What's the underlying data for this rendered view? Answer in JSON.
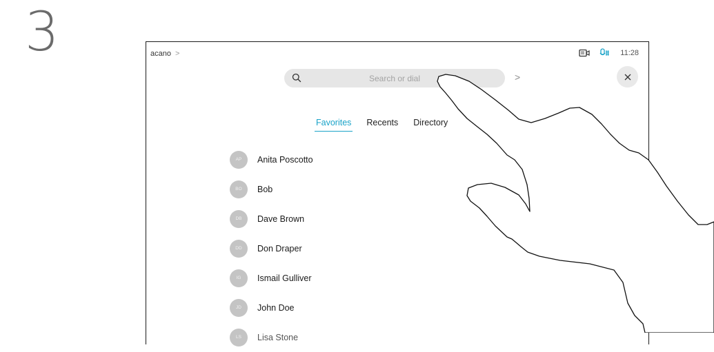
{
  "step": {
    "number": "3"
  },
  "header": {
    "breadcrumb": "acano",
    "time": "11:28",
    "icons": [
      "camera-icon",
      "microphone-icon"
    ]
  },
  "search": {
    "placeholder": "Search or dial",
    "value": ""
  },
  "tabs": [
    {
      "label": "Favorites",
      "active": true
    },
    {
      "label": "Recents",
      "active": false
    },
    {
      "label": "Directory",
      "active": false
    }
  ],
  "contacts": [
    {
      "initials": "AP",
      "name": "Anita Poscotto"
    },
    {
      "initials": "BO",
      "name": "Bob"
    },
    {
      "initials": "DB",
      "name": "Dave Brown"
    },
    {
      "initials": "DD",
      "name": "Don Draper"
    },
    {
      "initials": "IG",
      "name": "Ismail Gulliver"
    },
    {
      "initials": "JD",
      "name": "John Doe"
    },
    {
      "initials": "LS",
      "name": "Lisa Stone"
    }
  ],
  "colors": {
    "accent": "#1aa3c8",
    "avatar": "#c4c4c4",
    "search_bg": "#e6e6e6"
  }
}
